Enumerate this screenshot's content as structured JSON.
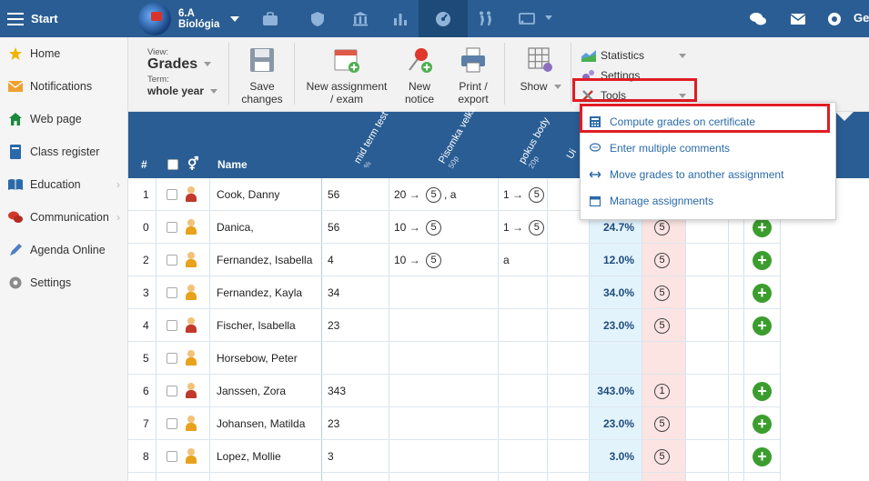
{
  "topbar": {
    "start_label": "Start",
    "class_name": "6.A",
    "subject": "Biológia",
    "user_initial": "Ge"
  },
  "sidebar": {
    "items": [
      {
        "label": "Home",
        "icon": "star-icon",
        "color": "#f0b400",
        "has_submenu": false
      },
      {
        "label": "Notifications",
        "icon": "envelope-icon",
        "color": "#f0a030",
        "has_submenu": false
      },
      {
        "label": "Web page",
        "icon": "house-icon",
        "color": "#1b8a3e",
        "has_submenu": false
      },
      {
        "label": "Class register",
        "icon": "register-icon",
        "color": "#2a6aa8",
        "has_submenu": false
      },
      {
        "label": "Education",
        "icon": "book-icon",
        "color": "#2a6aa8",
        "has_submenu": true
      },
      {
        "label": "Communication",
        "icon": "chat-icon",
        "color": "#d03a2a",
        "has_submenu": true
      },
      {
        "label": "Agenda Online",
        "icon": "pen-icon",
        "color": "#4f7fc0",
        "has_submenu": false
      },
      {
        "label": "Settings",
        "icon": "gear-icon",
        "color": "#8a8a8a",
        "has_submenu": false
      }
    ]
  },
  "toolbar": {
    "view_label": "View:",
    "view_value": "Grades",
    "term_label": "Term:",
    "term_value": "whole year",
    "save_label_1": "Save",
    "save_label_2": "changes",
    "new_assignment_1": "New assignment",
    "new_assignment_2": "/ exam",
    "new_notice_1": "New",
    "new_notice_2": "notice",
    "print_1": "Print /",
    "print_2": "export",
    "show_label": "Show",
    "statistics_label": "Statistics",
    "settings_label": "Settings",
    "tools_label": "Tools"
  },
  "tools_menu": {
    "items": [
      {
        "label": "Compute grades on certificate",
        "icon": "calculator-icon"
      },
      {
        "label": "Enter multiple comments",
        "icon": "comment-icon"
      },
      {
        "label": "Move grades to another assignment",
        "icon": "arrows-icon"
      },
      {
        "label": "Manage assignments",
        "icon": "calendar-icon"
      }
    ]
  },
  "grid": {
    "col_number": "#",
    "col_name": "Name",
    "assignments": [
      {
        "name": "mid term test",
        "sub": "%"
      },
      {
        "name": "Pisomka velka",
        "sub": "50p"
      },
      {
        "name": "pokus body",
        "sub": "20p"
      },
      {
        "name": "Ui",
        "sub": ""
      }
    ],
    "rows": [
      {
        "num": "1",
        "name": "Cook, Danny",
        "gender": "male",
        "a1": "56",
        "a2_from": "20",
        "a2_to": "5",
        "a2_extra": ", a",
        "a3_from": "1",
        "a3_to": "5",
        "a3_text": "",
        "pct": "",
        "cert": "",
        "plus": false
      },
      {
        "num": "0",
        "name": "Danica,",
        "gender": "female",
        "a1": "56",
        "a2_from": "10",
        "a2_to": "5",
        "a2_extra": "",
        "a3_from": "1",
        "a3_to": "5",
        "a3_text": "",
        "pct": "24.7%",
        "cert": "5",
        "plus": true
      },
      {
        "num": "2",
        "name": "Fernandez, Isabella",
        "gender": "female",
        "a1": "4",
        "a2_from": "10",
        "a2_to": "5",
        "a2_extra": "",
        "a3_from": "",
        "a3_to": "",
        "a3_text": "a",
        "pct": "12.0%",
        "cert": "5",
        "plus": true
      },
      {
        "num": "3",
        "name": "Fernandez, Kayla",
        "gender": "female",
        "a1": "34",
        "a2_from": "",
        "a2_to": "",
        "a2_extra": "",
        "a3_from": "",
        "a3_to": "",
        "a3_text": "",
        "pct": "34.0%",
        "cert": "5",
        "plus": true
      },
      {
        "num": "4",
        "name": "Fischer, Isabella",
        "gender": "male",
        "a1": "23",
        "a2_from": "",
        "a2_to": "",
        "a2_extra": "",
        "a3_from": "",
        "a3_to": "",
        "a3_text": "",
        "pct": "23.0%",
        "cert": "5",
        "plus": true
      },
      {
        "num": "5",
        "name": "Horsebow, Peter",
        "gender": "female",
        "a1": "",
        "a2_from": "",
        "a2_to": "",
        "a2_extra": "",
        "a3_from": "",
        "a3_to": "",
        "a3_text": "",
        "pct": "",
        "cert": "",
        "plus": false
      },
      {
        "num": "6",
        "name": "Janssen, Zora",
        "gender": "male",
        "a1": "343",
        "a2_from": "",
        "a2_to": "",
        "a2_extra": "",
        "a3_from": "",
        "a3_to": "",
        "a3_text": "",
        "pct": "343.0%",
        "cert": "1",
        "plus": true
      },
      {
        "num": "7",
        "name": "Johansen, Matilda",
        "gender": "female",
        "a1": "23",
        "a2_from": "",
        "a2_to": "",
        "a2_extra": "",
        "a3_from": "",
        "a3_to": "",
        "a3_text": "",
        "pct": "23.0%",
        "cert": "5",
        "plus": true
      },
      {
        "num": "8",
        "name": "Lopez, Mollie",
        "gender": "female",
        "a1": "3",
        "a2_from": "",
        "a2_to": "",
        "a2_extra": "",
        "a3_from": "",
        "a3_to": "",
        "a3_text": "",
        "pct": "3.0%",
        "cert": "5",
        "plus": true
      }
    ]
  },
  "colors": {
    "header_blue": "#2a5d93",
    "highlight_red": "#e01c24",
    "percent_col_bg": "#e3f3fc",
    "cert_col_bg": "#fbe4e1",
    "add_green": "#3c9d2f",
    "male_shirt": "#c0392b",
    "female_shirt": "#e8a21b"
  }
}
